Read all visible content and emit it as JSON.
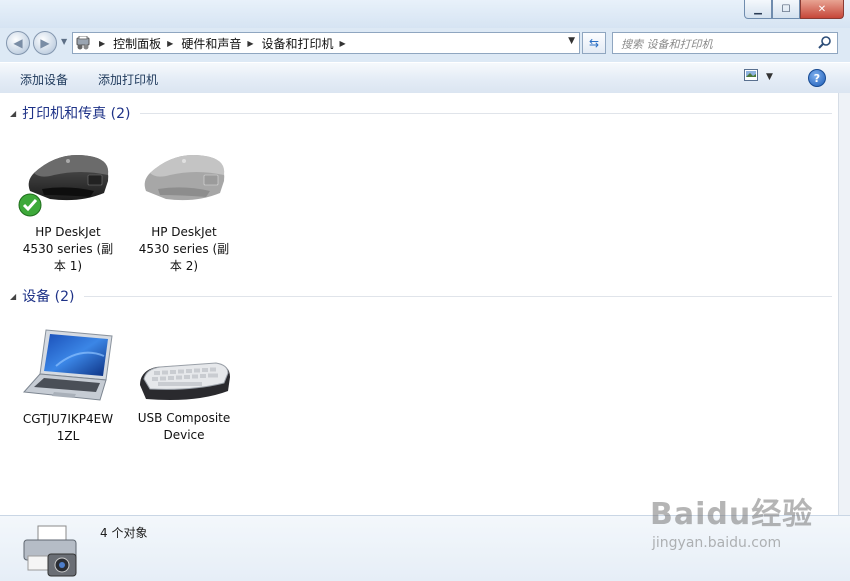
{
  "window": {
    "minimize_icon": "minimize-icon",
    "maximize_icon": "maximize-icon",
    "close_icon": "close-icon"
  },
  "address": {
    "crumbs": [
      "控制面板",
      "硬件和声音",
      "设备和打印机"
    ],
    "search_placeholder": "搜索 设备和打印机"
  },
  "toolbar": {
    "add_device": "添加设备",
    "add_printer": "添加打印机"
  },
  "groups": [
    {
      "title": "打印机和传真 (2)",
      "devices": [
        {
          "name_line1": "HP DeskJet",
          "name_line2": "4530 series (副",
          "name_line3": "本 1)",
          "default": true
        },
        {
          "name_line1": "HP DeskJet",
          "name_line2": "4530 series (副",
          "name_line3": "本 2)",
          "default": false
        }
      ]
    },
    {
      "title": "设备 (2)",
      "devices": [
        {
          "name_line1": "CGTJU7IKP4EW",
          "name_line2": "1ZL"
        },
        {
          "name_line1": "USB Composite",
          "name_line2": "Device"
        }
      ]
    }
  ],
  "status": {
    "count": "4 个对象"
  },
  "watermark": {
    "brand": "Baidu经验",
    "url": "jingyan.baidu.com"
  }
}
